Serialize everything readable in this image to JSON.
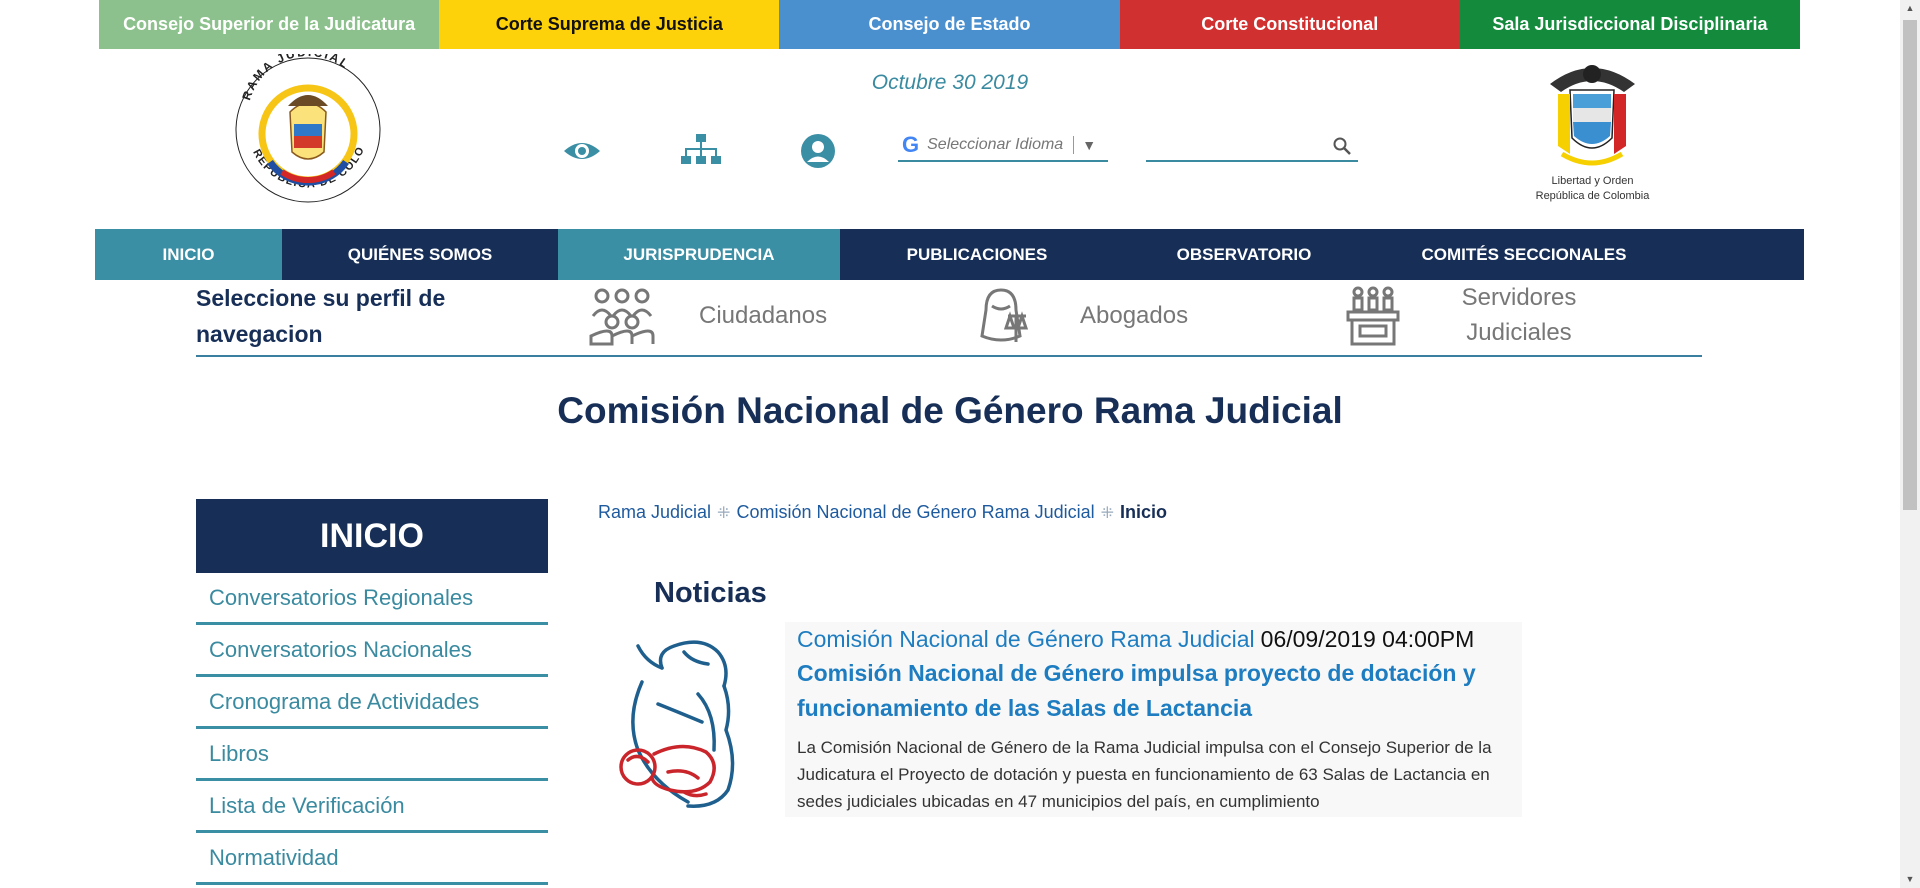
{
  "topbar": [
    {
      "label": "Consejo Superior de la Judicatura",
      "bg": "#8cc08c",
      "fg": "#ffffff"
    },
    {
      "label": "Corte Suprema de Justicia",
      "bg": "#fdd20a",
      "fg": "#111111"
    },
    {
      "label": "Consejo de Estado",
      "bg": "#4a90cf",
      "fg": "#ffffff"
    },
    {
      "label": "Corte Constitucional",
      "bg": "#d03030",
      "fg": "#ffffff"
    },
    {
      "label": "Sala Jurisdiccional Disciplinaria",
      "bg": "#138a3c",
      "fg": "#ffffff"
    }
  ],
  "header": {
    "date": "Octubre 30 2019",
    "language_placeholder": "Seleccionar Idioma",
    "logo_right_line1": "Libertad y Orden",
    "logo_right_line2": "República de Colombia"
  },
  "nav": [
    {
      "label": "INICIO",
      "active": true
    },
    {
      "label": "QUIÉNES SOMOS",
      "active": false
    },
    {
      "label": "JURISPRUDENCIA",
      "active": true
    },
    {
      "label": "PUBLICACIONES",
      "active": false
    },
    {
      "label": "OBSERVATORIO",
      "active": false
    },
    {
      "label": "COMITÉS SECCIONALES",
      "active": false
    }
  ],
  "profile": {
    "label": "Seleccione su perfil de navegacion",
    "items": [
      "Ciudadanos",
      "Abogados",
      "Servidores Judiciales"
    ]
  },
  "page_title": "Comisión Nacional de Género Rama Judicial",
  "sidebar": {
    "title": "INICIO",
    "items": [
      "Conversatorios Regionales",
      "Conversatorios Nacionales",
      "Cronograma de Actividades",
      "Libros",
      "Lista de Verificación",
      "Normatividad"
    ]
  },
  "breadcrumb": [
    "Rama Judicial",
    "Comisión Nacional de Género Rama Judicial",
    "Inicio"
  ],
  "news": {
    "section": "Noticias",
    "source": "Comisión Nacional de Género Rama Judicial",
    "datetime": "06/09/2019 04:00PM",
    "headline": "Comisión Nacional de Género impulsa proyecto de dotación y funcionamiento de las Salas de Lactancia",
    "body": "La Comisión Nacional de Género de la Rama Judicial impulsa con el Consejo Superior de la Judicatura el Proyecto de dotación y puesta en funcionamiento de 63 Salas de Lactancia en sedes judiciales ubicadas en 47 municipios del país, en cumplimiento"
  },
  "colors": {
    "navy": "#172f57",
    "teal": "#3b8fa5"
  }
}
